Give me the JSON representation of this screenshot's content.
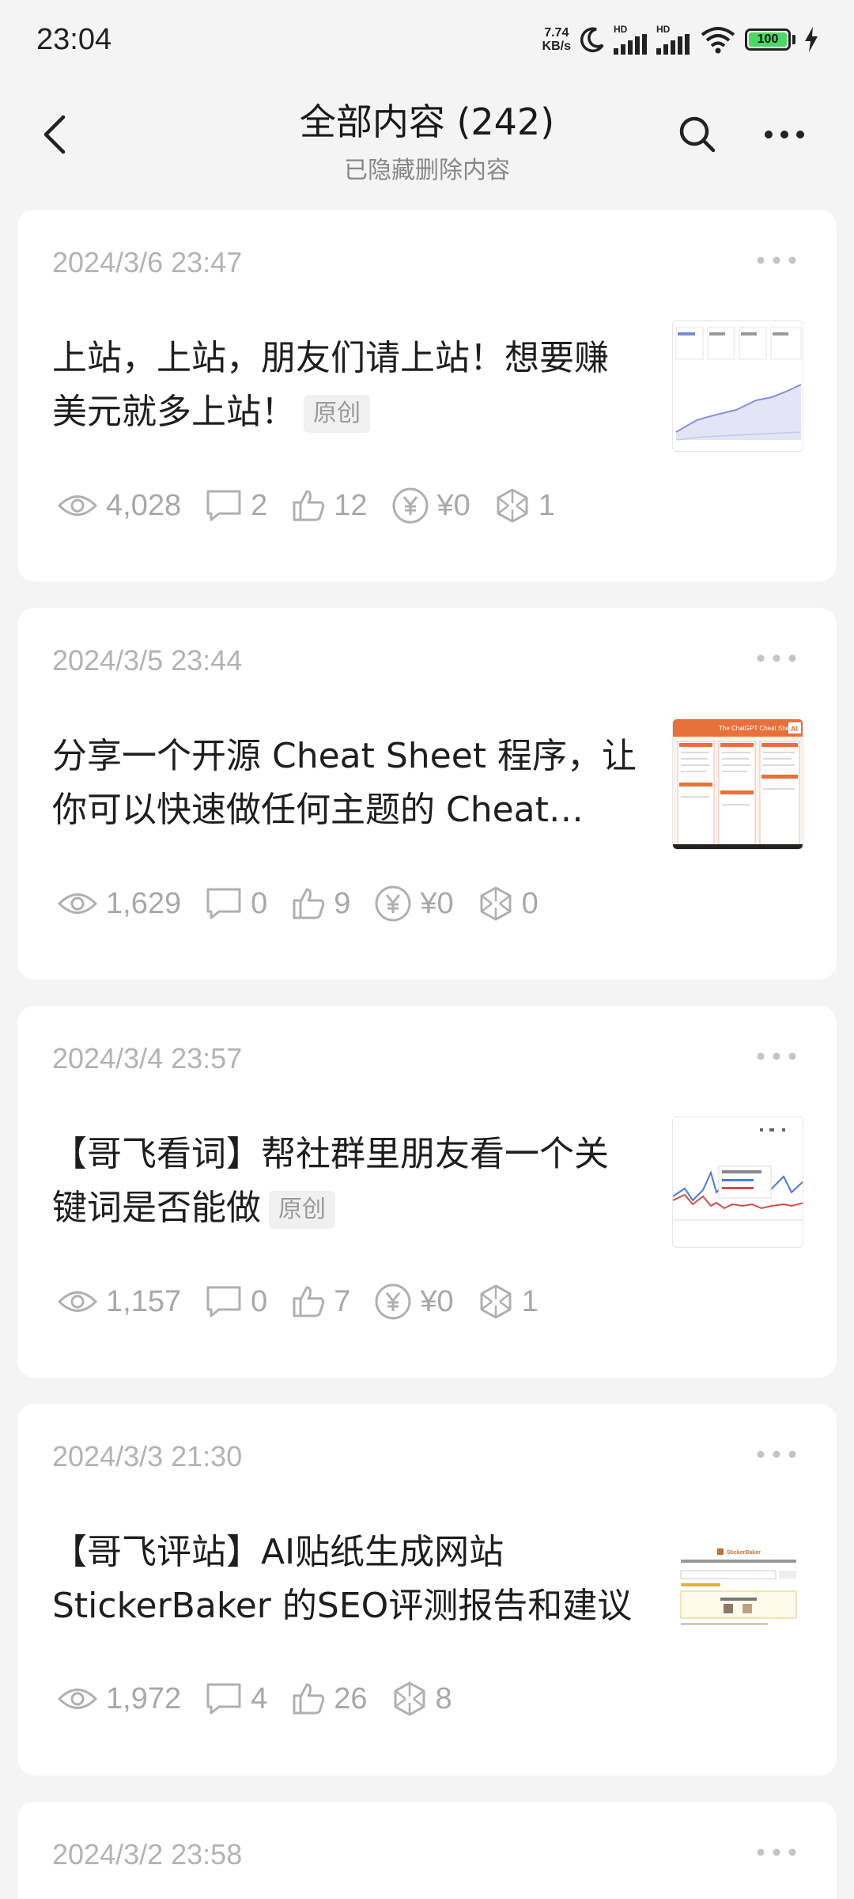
{
  "status": {
    "time": "23:04",
    "net_speed_value": "7.74",
    "net_speed_unit": "KB/s",
    "signal_label": "HD",
    "battery": "100"
  },
  "header": {
    "title": "全部内容 (242)",
    "subtitle": "已隐藏删除内容"
  },
  "posts": [
    {
      "date": "2024/3/6 23:47",
      "title": "上站，上站，朋友们请上站！想要赚美元就多上站！",
      "badge": "原创",
      "views": "4,028",
      "comments": "2",
      "likes": "12",
      "income": "¥0",
      "shares": "1"
    },
    {
      "date": "2024/3/5 23:44",
      "title": "分享一个开源 Cheat Sheet 程序，让你可以快速做任何主题的 Cheat Sheet",
      "views": "1,629",
      "comments": "0",
      "likes": "9",
      "income": "¥0",
      "shares": "0",
      "thumb_title": "The ChatGPT Cheat Sheet",
      "thumb_badge": "AI"
    },
    {
      "date": "2024/3/4 23:57",
      "title": "【哥飞看词】帮社群里朋友看一个关键词是否能做",
      "badge": "原创",
      "views": "1,157",
      "comments": "0",
      "likes": "7",
      "income": "¥0",
      "shares": "1"
    },
    {
      "date": "2024/3/3 21:30",
      "title": "【哥飞评站】AI贴纸生成网站StickerBaker 的SEO评测报告和建议",
      "views": "1,972",
      "comments": "4",
      "likes": "26",
      "shares": "8",
      "thumb_title": "StickerBaker"
    },
    {
      "date": "2024/3/2 23:58"
    }
  ],
  "colors": {
    "accent_orange": "#e8703a",
    "stat_gray": "#a8a8a8",
    "battery_green": "#4bd964"
  }
}
